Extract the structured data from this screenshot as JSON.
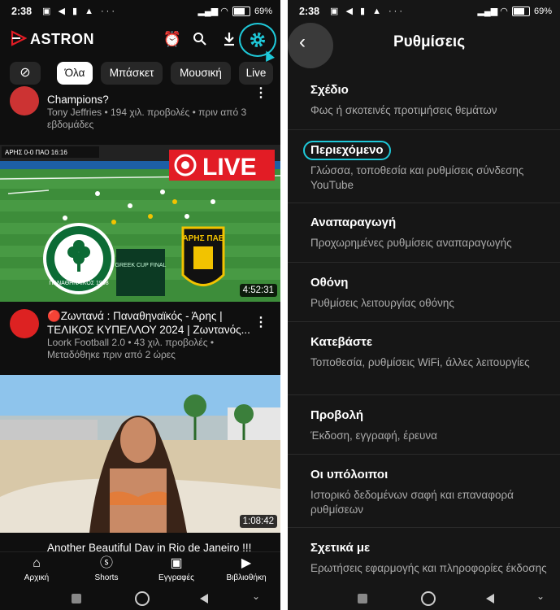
{
  "status_bar": {
    "time": "2:38",
    "battery": "69%"
  },
  "left": {
    "app_name": "ASTRON",
    "chips": [
      "Όλα",
      "Μπάσκετ",
      "Μουσική",
      "Live"
    ],
    "video0": {
      "title": "Champions?",
      "meta": "Tony Jeffries • 194 χιλ. προβολές • πριν από 3 εβδομάδες"
    },
    "video1": {
      "live_badge": "LIVE",
      "duration": "4:52:31",
      "title": "🔴Ζωντανά : Παναθηναϊκός - Άρης | ΤΕΛΙΚΟΣ ΚΥΠΕΛΛΟΥ 2024 | Ζωντανός...",
      "meta": "Loork Football 2.0 • 43 χιλ. προβολές • Μεταδόθηκε πριν από 2 ώρες",
      "scoreboard": "ΑΡΗΣ 0-0 ΠΑΟ 16:16",
      "club1": "ΠΑΝΑΘΗΝΑΪΚΟΣ 1908",
      "club2": "ΑΡΗΣ ΠΑΕ",
      "cup": "GREEK CUP FINAL"
    },
    "video2": {
      "duration": "1:08:42",
      "title": "Another Beautiful Day in Rio de Janeiro !!!"
    },
    "nav": [
      "Αρχική",
      "Shorts",
      "Εγγραφές",
      "Βιβλιοθήκη"
    ],
    "colors": {
      "accent": "#1fc9d9",
      "live_red": "#e21c25"
    }
  },
  "right": {
    "title": "Ρυθμίσεις",
    "items": [
      {
        "title": "Σχέδιο",
        "subtitle": "Φως ή σκοτεινές προτιμήσεις θεμάτων"
      },
      {
        "title": "Περιεχόμενο",
        "subtitle": "Γλώσσα, τοποθεσία και ρυθμίσεις σύνδεσης YouTube"
      },
      {
        "title": "Αναπαραγωγή",
        "subtitle": "Προχωρημένες ρυθμίσεις αναπαραγωγής"
      },
      {
        "title": "Οθόνη",
        "subtitle": "Ρυθμίσεις λειτουργίας οθόνης"
      },
      {
        "title": "Κατεβάστε",
        "subtitle": "Τοποθεσία, ρυθμίσεις WiFi, άλλες λειτουργίες"
      },
      {
        "title": "Προβολή",
        "subtitle": "Έκδοση, εγγραφή, έρευνα"
      },
      {
        "title": "Οι υπόλοιποι",
        "subtitle": "Ιστορικό δεδομένων σαφή και επαναφορά ρυθμίσεων"
      },
      {
        "title": "Σχετικά με",
        "subtitle": "Ερωτήσεις εφαρμογής και πληροφορίες έκδοσης"
      }
    ]
  }
}
